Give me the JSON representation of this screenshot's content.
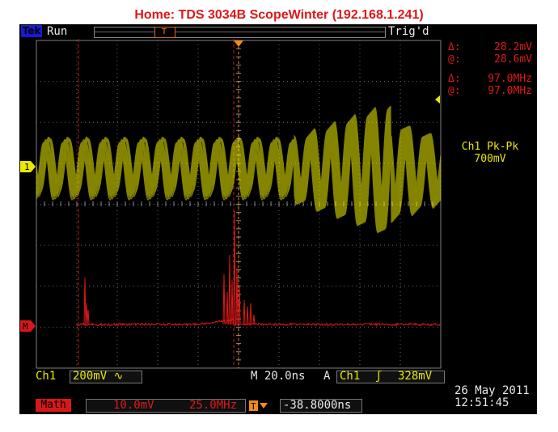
{
  "page_title": "Home:  TDS 3034B  ScopeWinter  (192.168.1.241)",
  "header": {
    "logo": "Tek",
    "run_state": "Run",
    "trigger_state": "Trig'd"
  },
  "cursor_readouts": {
    "amplitude": [
      {
        "symbol": "Δ:",
        "value": "28.2mV"
      },
      {
        "symbol": "@:",
        "value": "28.6mV"
      }
    ],
    "frequency": [
      {
        "symbol": "Δ:",
        "value": "97.0MHz"
      },
      {
        "symbol": "@:",
        "value": "97.0MHz"
      }
    ]
  },
  "measurement": {
    "label": "Ch1 Pk-Pk",
    "value": "700mV"
  },
  "channel1": {
    "label": "Ch1",
    "scale": "200mV",
    "coupling_symbol": "∿",
    "marker": "1"
  },
  "math": {
    "label": "Math",
    "scale": "10.0mV",
    "span": "25.0MHz",
    "marker": "M"
  },
  "horizontal": {
    "scale": "M 20.0ns",
    "trigger_position": "-38.8000ns"
  },
  "trigger": {
    "label": "A",
    "source": "Ch1",
    "slope_symbol": "ʃ",
    "level": "328mV"
  },
  "timestamp": {
    "date": "26 May 2011",
    "time": "12:51:45"
  },
  "colors": {
    "channel1": "#f0f000",
    "math": "#e01818",
    "cursor": "#c01818",
    "trigger_marker": "#f08a1a",
    "grid": "#7a7a7a"
  }
}
